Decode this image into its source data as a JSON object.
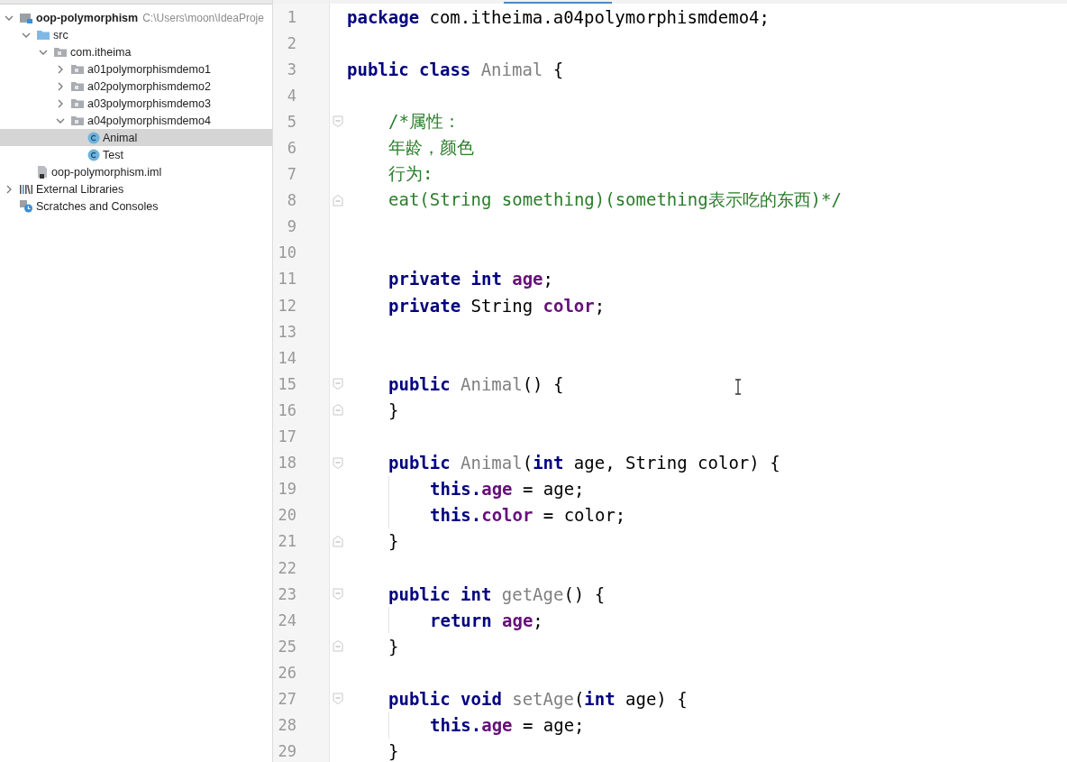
{
  "project_tree": [
    {
      "label": "oop-polymorphism",
      "path": "C:\\Users\\moon\\IdeaProje",
      "kind": "module",
      "expanded": true,
      "selected": false,
      "children": [
        {
          "label": "src",
          "kind": "folder",
          "expanded": true,
          "selected": false,
          "children": [
            {
              "label": "com.itheima",
              "kind": "package",
              "expanded": true,
              "selected": false,
              "children": [
                {
                  "label": "a01polymorphismdemo1",
                  "kind": "package",
                  "expanded": false,
                  "selected": false
                },
                {
                  "label": "a02polymorphismdemo2",
                  "kind": "package",
                  "expanded": false,
                  "selected": false
                },
                {
                  "label": "a03polymorphismdemo3",
                  "kind": "package",
                  "expanded": false,
                  "selected": false
                },
                {
                  "label": "a04polymorphismdemo4",
                  "kind": "package",
                  "expanded": true,
                  "selected": false,
                  "children": [
                    {
                      "label": "Animal",
                      "kind": "class",
                      "selected": true
                    },
                    {
                      "label": "Test",
                      "kind": "class",
                      "selected": false
                    }
                  ]
                }
              ]
            }
          ]
        },
        {
          "label": "oop-polymorphism.iml",
          "kind": "file",
          "selected": false
        }
      ]
    },
    {
      "label": "External Libraries",
      "kind": "libraries",
      "expanded": false,
      "selected": false
    },
    {
      "label": "Scratches and Consoles",
      "kind": "scratches",
      "selected": false
    }
  ],
  "editor": {
    "lines": [
      {
        "number": "1",
        "tokens": [
          {
            "kind": "keyword",
            "text": "package"
          },
          {
            "kind": "plain",
            "text": "com.itheima.a04polymorphismdemo4;"
          }
        ]
      },
      {
        "number": "2"
      },
      {
        "number": "3",
        "tokens": [
          {
            "kind": "keyword",
            "text": "public class"
          },
          {
            "kind": "name",
            "text": "Animal"
          },
          {
            "kind": "plain",
            "text": "{"
          }
        ],
        "children": [
          {
            "number": "4"
          },
          {
            "number": "5",
            "fold_start": true,
            "tokens": [
              {
                "kind": "comment",
                "text": "/*属性："
              }
            ]
          },
          {
            "number": "6",
            "tokens": [
              {
                "kind": "comment",
                "text": "年龄，颜色"
              }
            ]
          },
          {
            "number": "7",
            "tokens": [
              {
                "kind": "comment",
                "text": "行为:"
              }
            ]
          },
          {
            "number": "8",
            "fold_end": true,
            "tokens": [
              {
                "kind": "comment",
                "text": "eat(String something)(something表示吃的东西)*/"
              }
            ]
          },
          {
            "number": "9"
          },
          {
            "number": "10"
          },
          {
            "number": "11",
            "tokens": [
              {
                "kind": "keyword",
                "text": "private int"
              },
              {
                "kind": "field",
                "text": "age"
              },
              {
                "kind": "plain",
                "text": ";"
              }
            ]
          },
          {
            "number": "12",
            "tokens": [
              {
                "kind": "keyword",
                "text": "private"
              },
              {
                "kind": "plain",
                "text": "String"
              },
              {
                "kind": "field",
                "text": "color"
              },
              {
                "kind": "plain",
                "text": ";"
              }
            ]
          },
          {
            "number": "13"
          },
          {
            "number": "14"
          },
          {
            "number": "15",
            "fold_start": true,
            "tokens": [
              {
                "kind": "keyword",
                "text": "public"
              },
              {
                "kind": "name",
                "text": "Animal"
              },
              {
                "kind": "plain",
                "text": "() {"
              }
            ]
          },
          {
            "number": "16",
            "fold_end": true,
            "tokens": [
              {
                "kind": "plain",
                "text": "}"
              }
            ]
          },
          {
            "number": "17"
          },
          {
            "number": "18",
            "fold_start": true,
            "tokens": [
              {
                "kind": "keyword",
                "text": "public"
              },
              {
                "kind": "name",
                "text": "Animal"
              },
              {
                "kind": "plain",
                "text": "("
              },
              {
                "kind": "keyword",
                "text": "int"
              },
              {
                "kind": "plain",
                "text": "age, String color) {"
              }
            ],
            "children": [
              {
                "number": "19",
                "tokens": [
                  {
                    "kind": "keyword",
                    "text": "this."
                  },
                  {
                    "kind": "field",
                    "text": "age"
                  },
                  {
                    "kind": "plain",
                    "text": "= age;"
                  }
                ]
              },
              {
                "number": "20",
                "tokens": [
                  {
                    "kind": "keyword",
                    "text": "this."
                  },
                  {
                    "kind": "field",
                    "text": "color"
                  },
                  {
                    "kind": "plain",
                    "text": "= color;"
                  }
                ]
              }
            ]
          },
          {
            "number": "21",
            "fold_end": true,
            "tokens": [
              {
                "kind": "plain",
                "text": "}"
              }
            ]
          },
          {
            "number": "22"
          },
          {
            "number": "23",
            "fold_start": true,
            "tokens": [
              {
                "kind": "keyword",
                "text": "public int"
              },
              {
                "kind": "name",
                "text": "getAge"
              },
              {
                "kind": "plain",
                "text": "() {"
              }
            ],
            "children": [
              {
                "number": "24",
                "tokens": [
                  {
                    "kind": "keyword",
                    "text": "return"
                  },
                  {
                    "kind": "field",
                    "text": "age"
                  },
                  {
                    "kind": "plain",
                    "text": ";"
                  }
                ]
              }
            ]
          },
          {
            "number": "25",
            "fold_end": true,
            "tokens": [
              {
                "kind": "plain",
                "text": "}"
              }
            ]
          },
          {
            "number": "26"
          },
          {
            "number": "27",
            "fold_start": true,
            "tokens": [
              {
                "kind": "keyword",
                "text": "public void"
              },
              {
                "kind": "name",
                "text": "setAge"
              },
              {
                "kind": "plain",
                "text": "("
              },
              {
                "kind": "keyword",
                "text": "int"
              },
              {
                "kind": "plain",
                "text": "age) {"
              }
            ],
            "children": [
              {
                "number": "28",
                "tokens": [
                  {
                    "kind": "keyword",
                    "text": "this."
                  },
                  {
                    "kind": "field",
                    "text": "age"
                  },
                  {
                    "kind": "plain",
                    "text": "= age;"
                  }
                ]
              }
            ]
          },
          {
            "number": "29",
            "tokens": [
              {
                "kind": "plain",
                "text": "}"
              }
            ]
          }
        ]
      }
    ]
  }
}
